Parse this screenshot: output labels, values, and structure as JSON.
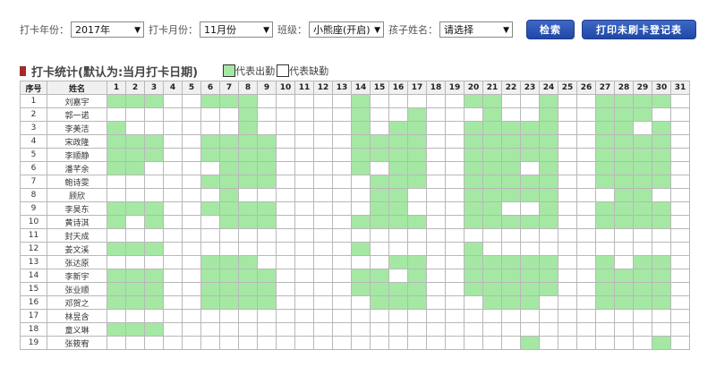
{
  "filters": {
    "year_label": "打卡年份：",
    "year_value": "2017年",
    "month_label": "打卡月份：",
    "month_value": "11月份",
    "class_label": "班级：",
    "class_value": "小熊座(开启)",
    "child_label": "孩子姓名：",
    "child_value": "请选择",
    "search_button": "检索",
    "print_button": "打印未刷卡登记表"
  },
  "stats": {
    "title": "打卡统计(默认为:当月打卡日期)",
    "legend_present": "代表出勤",
    "legend_absent": "代表缺勤"
  },
  "colors": {
    "present": "#a4e8a4",
    "absent": "#ffffff",
    "button": "#2f58b6",
    "title_mark": "#a52a2a"
  },
  "table": {
    "headers": {
      "index": "序号",
      "name": "姓名"
    },
    "days": [
      "1",
      "2",
      "3",
      "4",
      "5",
      "6",
      "7",
      "8",
      "9",
      "10",
      "11",
      "12",
      "13",
      "14",
      "15",
      "16",
      "17",
      "18",
      "19",
      "20",
      "21",
      "22",
      "23",
      "24",
      "25",
      "26",
      "27",
      "28",
      "29",
      "30",
      "31"
    ],
    "rows": [
      {
        "index": "1",
        "name": "刘嘉宇",
        "present_days": [
          1,
          2,
          3,
          6,
          7,
          8,
          14,
          20,
          21,
          24,
          27,
          28,
          29,
          30
        ]
      },
      {
        "index": "2",
        "name": "郭一诺",
        "present_days": [
          8,
          14,
          17,
          21,
          24,
          27,
          28,
          29
        ]
      },
      {
        "index": "3",
        "name": "李美洁",
        "present_days": [
          1,
          8,
          14,
          16,
          17,
          20,
          21,
          22,
          23,
          24,
          27,
          28,
          30
        ]
      },
      {
        "index": "4",
        "name": "宋政隆",
        "present_days": [
          1,
          2,
          3,
          6,
          7,
          8,
          9,
          14,
          15,
          16,
          17,
          20,
          21,
          22,
          23,
          24,
          27,
          28,
          29,
          30
        ]
      },
      {
        "index": "5",
        "name": "李顺静",
        "present_days": [
          1,
          2,
          3,
          6,
          7,
          8,
          9,
          14,
          15,
          16,
          17,
          20,
          21,
          22,
          23,
          24,
          27,
          28,
          29,
          30
        ]
      },
      {
        "index": "6",
        "name": "潘芊余",
        "present_days": [
          1,
          2,
          7,
          8,
          9,
          14,
          16,
          17,
          20,
          21,
          22,
          24,
          27,
          28,
          29,
          30
        ]
      },
      {
        "index": "7",
        "name": "鲍诗雯",
        "present_days": [
          6,
          7,
          8,
          9,
          15,
          16,
          17,
          20,
          21,
          22,
          23,
          24,
          27,
          28,
          29,
          30
        ]
      },
      {
        "index": "8",
        "name": "顾欣",
        "present_days": [
          7,
          15,
          16,
          20,
          21,
          22,
          23,
          24,
          28,
          29
        ]
      },
      {
        "index": "9",
        "name": "李昊东",
        "present_days": [
          1,
          2,
          3,
          6,
          7,
          8,
          9,
          15,
          16,
          20,
          21,
          24,
          27,
          28,
          29,
          30
        ]
      },
      {
        "index": "10",
        "name": "黄诗淇",
        "present_days": [
          1,
          3,
          7,
          8,
          9,
          14,
          15,
          16,
          17,
          20,
          21,
          22,
          23,
          24,
          27,
          28,
          29,
          30
        ]
      },
      {
        "index": "11",
        "name": "封天成",
        "present_days": []
      },
      {
        "index": "12",
        "name": "姜文溪",
        "present_days": [
          1,
          2,
          3,
          14,
          20
        ]
      },
      {
        "index": "13",
        "name": "张达原",
        "present_days": [
          6,
          7,
          8,
          16,
          17,
          20,
          21,
          22,
          23,
          24,
          27,
          29,
          30
        ]
      },
      {
        "index": "14",
        "name": "李新宇",
        "present_days": [
          1,
          2,
          3,
          6,
          7,
          8,
          9,
          14,
          15,
          17,
          20,
          21,
          22,
          23,
          24,
          27,
          28,
          29,
          30
        ]
      },
      {
        "index": "15",
        "name": "张业顺",
        "present_days": [
          1,
          2,
          3,
          6,
          7,
          8,
          9,
          14,
          15,
          16,
          17,
          20,
          21,
          22,
          23,
          24,
          27,
          28,
          29,
          30
        ]
      },
      {
        "index": "16",
        "name": "邓贺之",
        "present_days": [
          1,
          2,
          3,
          6,
          7,
          8,
          9,
          15,
          16,
          17,
          21,
          22,
          23,
          27,
          28,
          29,
          30
        ]
      },
      {
        "index": "17",
        "name": "林昱含",
        "present_days": []
      },
      {
        "index": "18",
        "name": "童义琳",
        "present_days": [
          1,
          2,
          3
        ]
      },
      {
        "index": "19",
        "name": "张筱宥",
        "present_days": [
          23,
          30
        ]
      }
    ]
  }
}
